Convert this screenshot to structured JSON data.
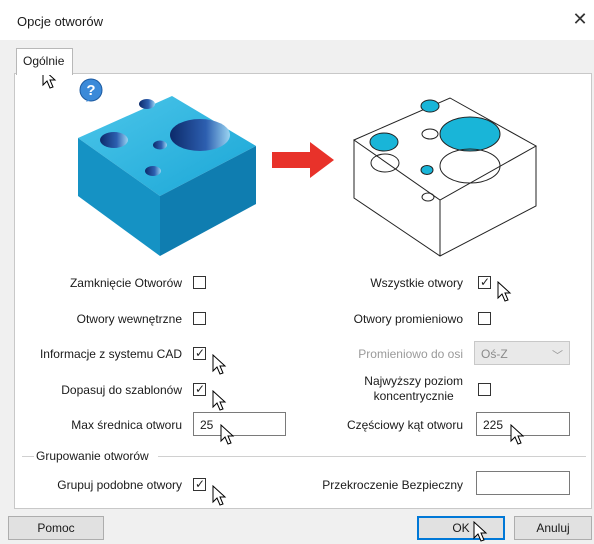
{
  "window": {
    "title": "Opcje otworów",
    "close_glyph": "✕"
  },
  "tabs": [
    {
      "label": "Ogólnie"
    }
  ],
  "icons": {
    "help": "question-mark",
    "arrow": "right-arrow",
    "solid_block": "isometric-block-with-holes",
    "wire_block": "wireframe-block-with-holes"
  },
  "colors": {
    "accent": "#0078d7",
    "block": "#19a8d6",
    "arrow": "#e8322a"
  },
  "left": {
    "close_holes": {
      "label": "Zamknięcie Otworów",
      "checked": false
    },
    "internal_holes": {
      "label": "Otwory wewnętrzne",
      "checked": false
    },
    "cad_info": {
      "label": "Informacje z systemu CAD",
      "checked": true
    },
    "fit_templates": {
      "label": "Dopasuj do szablonów",
      "checked": true
    },
    "max_diameter": {
      "label": "Max średnica otworu",
      "value": "25"
    }
  },
  "right": {
    "all_holes": {
      "label": "Wszystkie otwory",
      "checked": true
    },
    "radial_holes": {
      "label": "Otwory promieniowo",
      "checked": false
    },
    "radial_axis": {
      "label": "Promieniowo do osi",
      "value": "Oś-Z"
    },
    "top_level": {
      "label_line1": "Najwyższy poziom",
      "label_line2": "koncentrycznie",
      "checked": false
    },
    "partial_angle": {
      "label": "Częściowy kąt otworu",
      "value": "225"
    }
  },
  "grouping": {
    "legend": "Grupowanie otworów",
    "group_similar": {
      "label": "Grupuj podobne otwory",
      "checked": true
    },
    "safety_exceed": {
      "label": "Przekroczenie Bezpieczny",
      "value": ""
    }
  },
  "buttons": {
    "help": "Pomoc",
    "ok": "OK",
    "cancel": "Anuluj"
  },
  "check_glyph": "✓"
}
